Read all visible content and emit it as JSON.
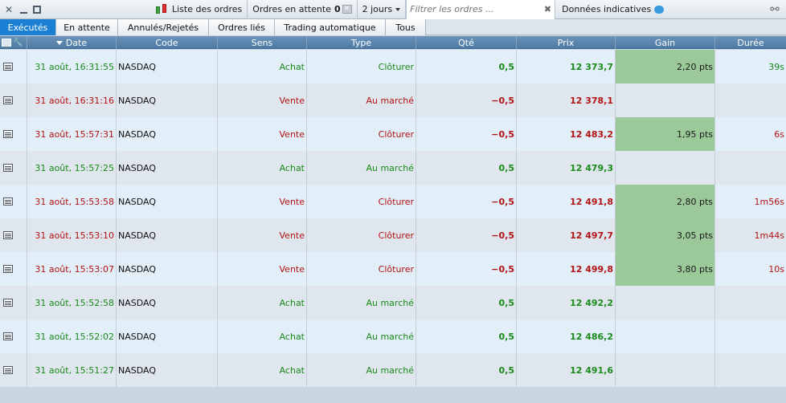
{
  "toolbar": {
    "orders_list": "Liste des ordres",
    "pending_orders": "Ordres en attente",
    "pending_count": "0",
    "period": "2 jours",
    "filter_placeholder": "Filtrer les ordres ...",
    "indicative_data": "Données indicatives"
  },
  "tabs": [
    {
      "label": "Exécutés",
      "active": true
    },
    {
      "label": "En attente",
      "active": false
    },
    {
      "label": "Annulés/Rejetés",
      "active": false
    },
    {
      "label": "Ordres liés",
      "active": false
    },
    {
      "label": "Trading automatique",
      "active": false
    },
    {
      "label": "Tous",
      "active": false
    }
  ],
  "columns": {
    "date": "Date",
    "code": "Code",
    "side": "Sens",
    "type": "Type",
    "qty": "Qté",
    "price": "Prix",
    "gain": "Gain",
    "duration": "Durée"
  },
  "colors": {
    "buy": "#1a8a1a",
    "sell": "#b31313",
    "gain_bg": "#9cc99a",
    "active_tab": "#1b7fd4"
  },
  "rows": [
    {
      "date": "31 août, 16:31:55",
      "code": "NASDAQ",
      "side": "Achat",
      "type": "Clôturer",
      "qty": "0,5",
      "price": "12 373,7",
      "gain": "2,20 pts",
      "duration": "39s",
      "dir": "buy"
    },
    {
      "date": "31 août, 16:31:16",
      "code": "NASDAQ",
      "side": "Vente",
      "type": "Au marché",
      "qty": "−0,5",
      "price": "12 378,1",
      "gain": "",
      "duration": "",
      "dir": "sell"
    },
    {
      "date": "31 août, 15:57:31",
      "code": "NASDAQ",
      "side": "Vente",
      "type": "Clôturer",
      "qty": "−0,5",
      "price": "12 483,2",
      "gain": "1,95 pts",
      "duration": "6s",
      "dir": "sell"
    },
    {
      "date": "31 août, 15:57:25",
      "code": "NASDAQ",
      "side": "Achat",
      "type": "Au marché",
      "qty": "0,5",
      "price": "12 479,3",
      "gain": "",
      "duration": "",
      "dir": "buy"
    },
    {
      "date": "31 août, 15:53:58",
      "code": "NASDAQ",
      "side": "Vente",
      "type": "Clôturer",
      "qty": "−0,5",
      "price": "12 491,8",
      "gain": "2,80 pts",
      "duration": "1m56s",
      "dir": "sell"
    },
    {
      "date": "31 août, 15:53:10",
      "code": "NASDAQ",
      "side": "Vente",
      "type": "Clôturer",
      "qty": "−0,5",
      "price": "12 497,7",
      "gain": "3,05 pts",
      "duration": "1m44s",
      "dir": "sell"
    },
    {
      "date": "31 août, 15:53:07",
      "code": "NASDAQ",
      "side": "Vente",
      "type": "Clôturer",
      "qty": "−0,5",
      "price": "12 499,8",
      "gain": "3,80 pts",
      "duration": "10s",
      "dir": "sell"
    },
    {
      "date": "31 août, 15:52:58",
      "code": "NASDAQ",
      "side": "Achat",
      "type": "Au marché",
      "qty": "0,5",
      "price": "12 492,2",
      "gain": "",
      "duration": "",
      "dir": "buy"
    },
    {
      "date": "31 août, 15:52:02",
      "code": "NASDAQ",
      "side": "Achat",
      "type": "Au marché",
      "qty": "0,5",
      "price": "12 486,2",
      "gain": "",
      "duration": "",
      "dir": "buy"
    },
    {
      "date": "31 août, 15:51:27",
      "code": "NASDAQ",
      "side": "Achat",
      "type": "Au marché",
      "qty": "0,5",
      "price": "12 491,6",
      "gain": "",
      "duration": "",
      "dir": "buy"
    }
  ]
}
